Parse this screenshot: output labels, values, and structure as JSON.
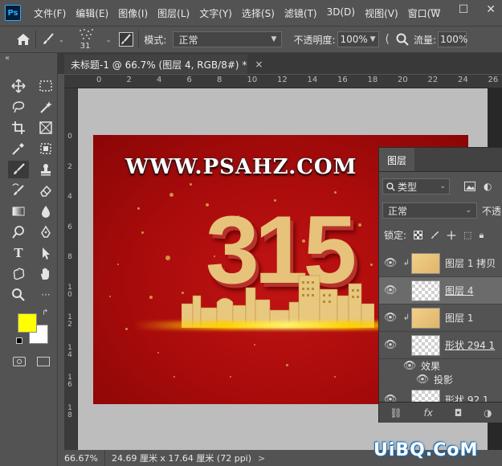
{
  "app": {
    "logo": "Ps"
  },
  "menu": [
    "文件(F)",
    "编辑(E)",
    "图像(I)",
    "图层(L)",
    "文字(Y)",
    "选择(S)",
    "滤镜(T)",
    "3D(D)",
    "视图(V)",
    "窗口(W"
  ],
  "window_buttons": {
    "minimize": "—",
    "maximize": "☐",
    "close": "✕"
  },
  "options": {
    "brush_size": "31",
    "mode_label": "模式:",
    "mode_value": "正常",
    "opacity_label": "不透明度:",
    "opacity_value": "100%",
    "flow_label": "流量:",
    "flow_value": "100%"
  },
  "document": {
    "tab_title": "未标题-1 @ 66.7% (图层 4, RGB/8#) *",
    "close": "×"
  },
  "ruler_top": [
    "0",
    "2",
    "4",
    "6",
    "8",
    "10",
    "12",
    "14",
    "16",
    "18",
    "20",
    "22",
    "24",
    "26"
  ],
  "ruler_left": [
    "0",
    "2",
    "4",
    "6",
    "8",
    "1 0",
    "1 2",
    "1 4",
    "1 6",
    "1 8"
  ],
  "artwork": {
    "url_text": "WWW.PSAHZ.COM",
    "big_number": "315"
  },
  "colors": {
    "foreground": "#ffff00",
    "background": "#ffffff"
  },
  "status": {
    "zoom": "66.67%",
    "doc_info": "24.69 厘米 x 17.64 厘米 (72 ppi)",
    "arrow": ">"
  },
  "layers_panel": {
    "tab": "图层",
    "filter_label": "类型",
    "blend_mode": "正常",
    "opacity_label": "不透",
    "lock_label": "锁定:",
    "layers": [
      {
        "name": "图层 1 拷贝",
        "thumb": "gold",
        "clipped": true,
        "selected": false
      },
      {
        "name": "图层 4",
        "thumb": "checker",
        "clipped": false,
        "selected": true
      },
      {
        "name": "图层 1",
        "thumb": "gold",
        "clipped": true,
        "selected": false
      },
      {
        "name": "形状 294 1",
        "thumb": "checker",
        "clipped": false,
        "selected": false
      },
      {
        "name": "形状 92 1",
        "thumb": "checker",
        "clipped": false,
        "selected": false
      }
    ],
    "effects_label": "效果",
    "effect_item": "投影",
    "footer": [
      "⛓",
      "fx",
      "◘",
      "◑"
    ]
  },
  "watermark": "UiBQ.CoM"
}
